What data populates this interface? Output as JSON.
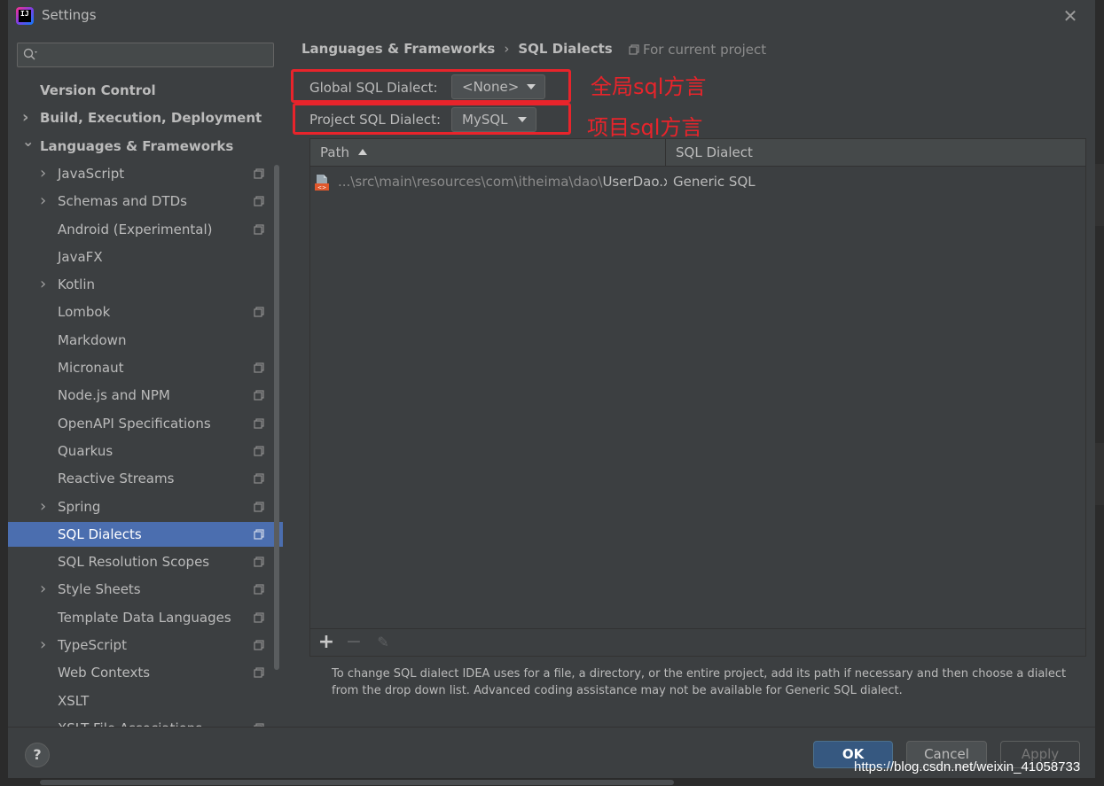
{
  "window": {
    "title": "Settings",
    "close_glyph": "✕"
  },
  "search": {
    "placeholder": "",
    "icon": "search-icon"
  },
  "sidebar": {
    "items": [
      {
        "label": "Version Control",
        "level": 0,
        "chevron": false,
        "bold": true,
        "project": false,
        "selected": false
      },
      {
        "label": "Build, Execution, Deployment",
        "level": 0,
        "chevron": true,
        "bold": true,
        "project": false,
        "selected": false
      },
      {
        "label": "Languages & Frameworks",
        "level": 0,
        "chevron": true,
        "expanded": true,
        "bold": true,
        "project": false,
        "selected": false
      },
      {
        "label": "JavaScript",
        "level": 1,
        "chevron": true,
        "bold": false,
        "project": true,
        "selected": false
      },
      {
        "label": "Schemas and DTDs",
        "level": 1,
        "chevron": true,
        "bold": false,
        "project": true,
        "selected": false
      },
      {
        "label": "Android (Experimental)",
        "level": 1,
        "chevron": false,
        "bold": false,
        "project": true,
        "selected": false
      },
      {
        "label": "JavaFX",
        "level": 1,
        "chevron": false,
        "bold": false,
        "project": false,
        "selected": false
      },
      {
        "label": "Kotlin",
        "level": 1,
        "chevron": true,
        "bold": false,
        "project": false,
        "selected": false
      },
      {
        "label": "Lombok",
        "level": 1,
        "chevron": false,
        "bold": false,
        "project": true,
        "selected": false
      },
      {
        "label": "Markdown",
        "level": 1,
        "chevron": false,
        "bold": false,
        "project": false,
        "selected": false
      },
      {
        "label": "Micronaut",
        "level": 1,
        "chevron": false,
        "bold": false,
        "project": true,
        "selected": false
      },
      {
        "label": "Node.js and NPM",
        "level": 1,
        "chevron": false,
        "bold": false,
        "project": true,
        "selected": false
      },
      {
        "label": "OpenAPI Specifications",
        "level": 1,
        "chevron": false,
        "bold": false,
        "project": true,
        "selected": false
      },
      {
        "label": "Quarkus",
        "level": 1,
        "chevron": false,
        "bold": false,
        "project": true,
        "selected": false
      },
      {
        "label": "Reactive Streams",
        "level": 1,
        "chevron": false,
        "bold": false,
        "project": true,
        "selected": false
      },
      {
        "label": "Spring",
        "level": 1,
        "chevron": true,
        "bold": false,
        "project": true,
        "selected": false
      },
      {
        "label": "SQL Dialects",
        "level": 1,
        "chevron": false,
        "bold": false,
        "project": true,
        "selected": true
      },
      {
        "label": "SQL Resolution Scopes",
        "level": 1,
        "chevron": false,
        "bold": false,
        "project": true,
        "selected": false
      },
      {
        "label": "Style Sheets",
        "level": 1,
        "chevron": true,
        "bold": false,
        "project": true,
        "selected": false
      },
      {
        "label": "Template Data Languages",
        "level": 1,
        "chevron": false,
        "bold": false,
        "project": true,
        "selected": false
      },
      {
        "label": "TypeScript",
        "level": 1,
        "chevron": true,
        "bold": false,
        "project": true,
        "selected": false
      },
      {
        "label": "Web Contexts",
        "level": 1,
        "chevron": false,
        "bold": false,
        "project": true,
        "selected": false
      },
      {
        "label": "XSLT",
        "level": 1,
        "chevron": false,
        "bold": false,
        "project": false,
        "selected": false
      },
      {
        "label": "XSLT File Associations",
        "level": 1,
        "chevron": false,
        "bold": false,
        "project": true,
        "selected": false
      }
    ]
  },
  "breadcrumb": {
    "parent": "Languages & Frameworks",
    "separator": "›",
    "current": "SQL Dialects",
    "scope": "For current project"
  },
  "global_dialect": {
    "label": "Global SQL Dialect:",
    "value": "<None>"
  },
  "project_dialect": {
    "label": "Project SQL Dialect:",
    "value": "MySQL"
  },
  "annotations": {
    "global": "全局sql方言",
    "project": "项目sql方言"
  },
  "table": {
    "columns": [
      "Path",
      "SQL Dialect"
    ],
    "sort_column": "Path",
    "rows": [
      {
        "path_prefix": "...\\src\\main\\resources\\com\\itheima\\dao\\",
        "file_name": "UserDao.xml",
        "dialect": "Generic SQL"
      }
    ],
    "toolbar": {
      "add": "+",
      "remove": "−",
      "edit": "✎"
    }
  },
  "hint": "To change SQL dialect IDEA uses for a file, a directory, or the entire project, add its path if necessary and then choose a dialect from the drop down list. Advanced coding assistance may not be available for Generic SQL dialect.",
  "footer": {
    "help": "?",
    "ok": "OK",
    "cancel": "Cancel",
    "apply": "Apply"
  },
  "watermark": "https://blog.csdn.net/weixin_41058733",
  "colors": {
    "background": "#3c3f41",
    "selection": "#4b6eaf",
    "ok_button": "#365880",
    "annotation_red": "#e8242b"
  }
}
